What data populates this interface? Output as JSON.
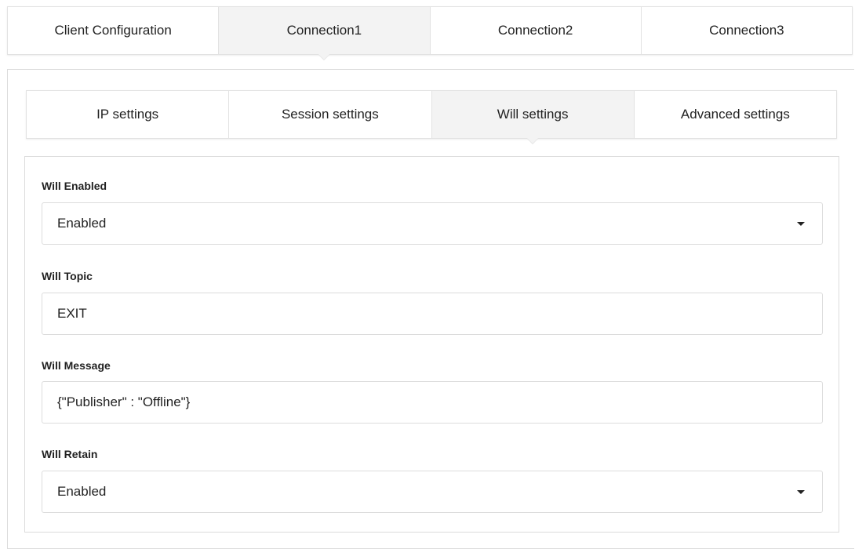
{
  "top_tabs": [
    {
      "label": "Client Configuration",
      "active": false
    },
    {
      "label": "Connection1",
      "active": true
    },
    {
      "label": "Connection2",
      "active": false
    },
    {
      "label": "Connection3",
      "active": false
    }
  ],
  "sub_tabs": [
    {
      "label": "IP settings",
      "active": false
    },
    {
      "label": "Session settings",
      "active": false
    },
    {
      "label": "Will settings",
      "active": true
    },
    {
      "label": "Advanced settings",
      "active": false
    }
  ],
  "form": {
    "will_enabled": {
      "label": "Will Enabled",
      "value": "Enabled",
      "icon": "chevron-down-icon"
    },
    "will_topic": {
      "label": "Will Topic",
      "value": "EXIT"
    },
    "will_message": {
      "label": "Will Message",
      "value": "{\"Publisher\" : \"Offline\"}"
    },
    "will_retain": {
      "label": "Will Retain",
      "value": "Enabled",
      "icon": "chevron-down-icon"
    }
  }
}
